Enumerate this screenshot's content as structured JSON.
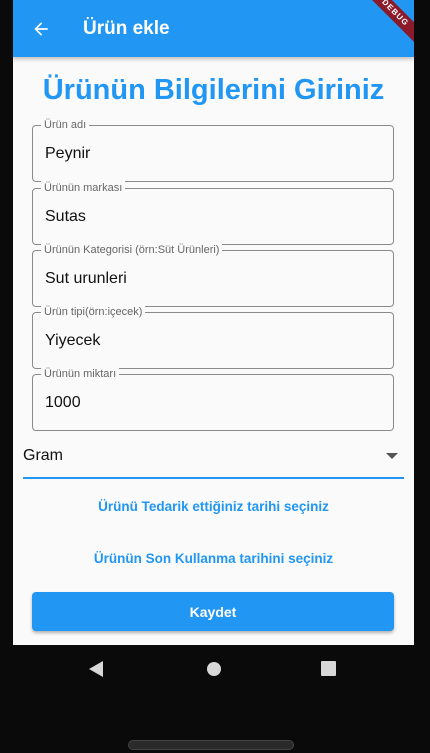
{
  "appbar": {
    "title": "Ürün ekle",
    "debug_label": "DEBUG",
    "accent_color": "#2196f3"
  },
  "form": {
    "heading": "Ürünün Bilgilerini Giriniz",
    "fields": [
      {
        "label": "Ürün adı",
        "value": "Peynir"
      },
      {
        "label": "Ürünün markası",
        "value": "Sutas"
      },
      {
        "label": "Ürünün Kategorisi (örn:Süt Ürünleri)",
        "value": "Sut urunleri"
      },
      {
        "label": "Ürün tipi(örn:içecek)",
        "value": "Yiyecek"
      },
      {
        "label": "Ürünün miktarı",
        "value": "1000"
      }
    ],
    "unit_dropdown": {
      "selected": "Gram"
    },
    "supply_date_button": "Ürünü Tedarik ettiğiniz tarihi seçiniz",
    "expiry_date_button": "Ürünün Son Kullanma tarihini seçiniz",
    "save_button": "Kaydet"
  },
  "navbar": {
    "icons": [
      "back-triangle-icon",
      "home-circle-icon",
      "recents-square-icon"
    ]
  }
}
